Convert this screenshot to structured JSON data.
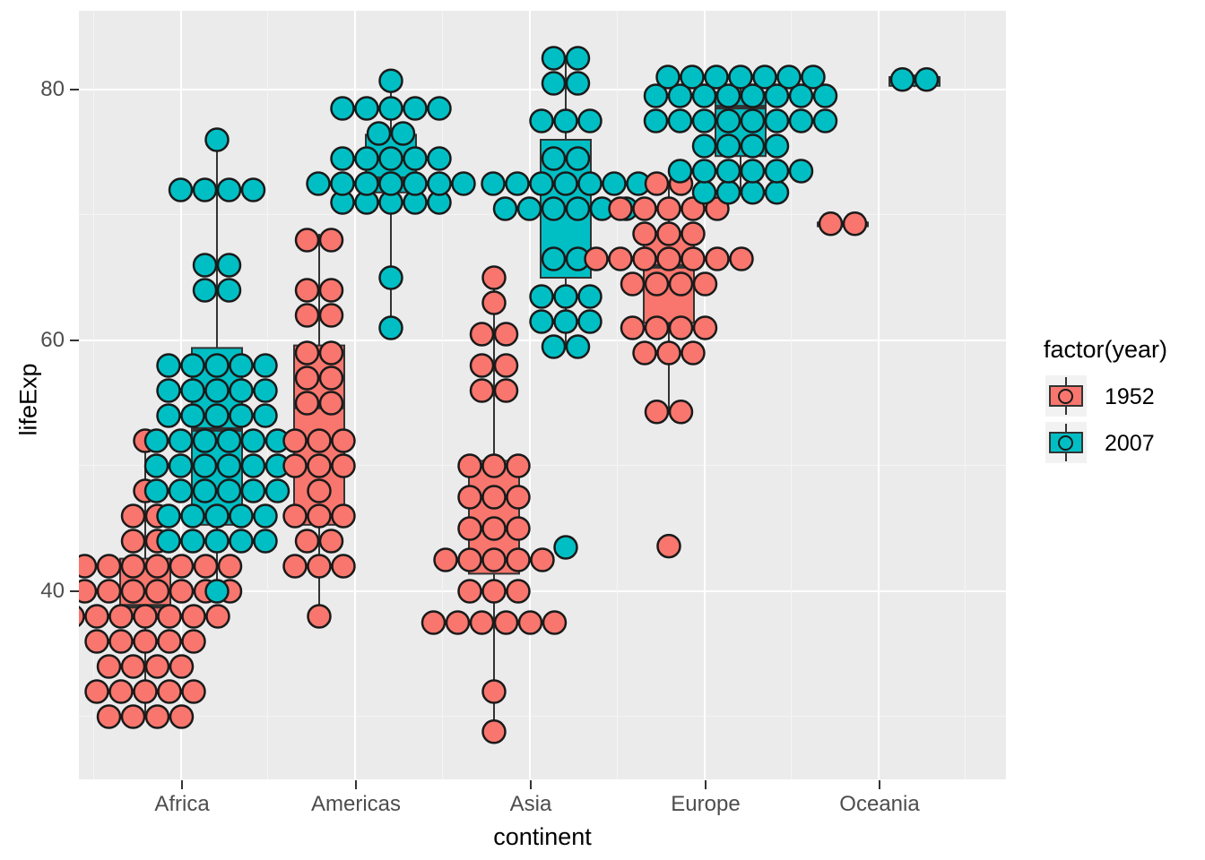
{
  "axes": {
    "y_title": "lifeExp",
    "x_title": "continent",
    "y_ticks": [
      "40",
      "60",
      "80"
    ],
    "x_ticks": [
      "Africa",
      "Americas",
      "Asia",
      "Europe",
      "Oceania"
    ]
  },
  "legend": {
    "title": "factor(year)",
    "items": [
      {
        "label": "1952",
        "color": "#F8766D"
      },
      {
        "label": "2007",
        "color": "#00BFC4"
      }
    ]
  },
  "colors": {
    "panel_bg": "#EBEBEB",
    "grid_major": "#FFFFFF",
    "grid_minor": "#F5F5F5",
    "outline": "#333333",
    "text": "#4D4D4D",
    "series_1952": "#F8766D",
    "series_2007": "#00BFC4"
  },
  "chart_data": {
    "type": "boxplot-dotplot",
    "title": "",
    "xlabel": "continent",
    "ylabel": "lifeExp",
    "ylim": [
      29,
      84
    ],
    "y_ticks": [
      40,
      60,
      80
    ],
    "y_minor_ticks": [
      30,
      50,
      70
    ],
    "grid": true,
    "legend_position": "right",
    "legend_title": "factor(year)",
    "categories": [
      "Africa",
      "Americas",
      "Asia",
      "Europe",
      "Oceania"
    ],
    "series": [
      {
        "name": "1952",
        "color": "#F8766D",
        "boxes": [
          {
            "category": "Africa",
            "lower_whisker": 30.0,
            "q1": 37.8,
            "median": 38.8,
            "q3": 42.6,
            "upper_whisker": 52.7,
            "outliers": []
          },
          {
            "category": "Americas",
            "lower_whisker": 37.6,
            "q1": 45.3,
            "median": 54.7,
            "q3": 59.6,
            "upper_whisker": 68.5,
            "outliers": []
          },
          {
            "category": "Asia",
            "lower_whisker": 28.8,
            "q1": 41.4,
            "median": 44.9,
            "q3": 50.4,
            "upper_whisker": 65.4,
            "outliers": []
          },
          {
            "category": "Europe",
            "lower_whisker": 54.3,
            "q1": 61.4,
            "median": 65.9,
            "q3": 68.5,
            "upper_whisker": 72.7,
            "outliers": [
              43.6
            ]
          },
          {
            "category": "Oceania",
            "lower_whisker": 69.1,
            "q1": 69.1,
            "median": 69.3,
            "q3": 69.4,
            "upper_whisker": 69.4,
            "outliers": []
          }
        ]
      },
      {
        "name": "2007",
        "color": "#00BFC4",
        "boxes": [
          {
            "category": "Africa",
            "lower_whisker": 39.6,
            "q1": 45.3,
            "median": 52.9,
            "q3": 59.4,
            "upper_whisker": 76.4,
            "outliers": []
          },
          {
            "category": "Americas",
            "lower_whisker": 60.9,
            "q1": 71.8,
            "median": 72.9,
            "q3": 76.4,
            "upper_whisker": 80.7,
            "outliers": []
          },
          {
            "category": "Asia",
            "lower_whisker": 59.5,
            "q1": 65.0,
            "median": 72.4,
            "q3": 76.0,
            "upper_whisker": 82.6,
            "outliers": []
          },
          {
            "category": "Europe",
            "lower_whisker": 71.8,
            "q1": 74.7,
            "median": 78.6,
            "q3": 79.8,
            "upper_whisker": 81.7,
            "outliers": []
          },
          {
            "category": "Oceania",
            "lower_whisker": 80.2,
            "q1": 80.3,
            "median": 80.7,
            "q3": 81.0,
            "upper_whisker": 81.2,
            "outliers": []
          }
        ]
      }
    ],
    "dot_rows": [
      {
        "category": "Africa",
        "series": "1952",
        "value": 30.0,
        "n": 4
      },
      {
        "category": "Africa",
        "series": "1952",
        "value": 32.0,
        "n": 5
      },
      {
        "category": "Africa",
        "series": "1952",
        "value": 34.0,
        "n": 4
      },
      {
        "category": "Africa",
        "series": "1952",
        "value": 36.0,
        "n": 5
      },
      {
        "category": "Africa",
        "series": "1952",
        "value": 38.0,
        "n": 7
      },
      {
        "category": "Africa",
        "series": "1952",
        "value": 40.0,
        "n": 8
      },
      {
        "category": "Africa",
        "series": "1952",
        "value": 42.0,
        "n": 8
      },
      {
        "category": "Africa",
        "series": "1952",
        "value": 44.0,
        "n": 2
      },
      {
        "category": "Africa",
        "series": "1952",
        "value": 46.0,
        "n": 2
      },
      {
        "category": "Africa",
        "series": "1952",
        "value": 48.0,
        "n": 1
      },
      {
        "category": "Africa",
        "series": "1952",
        "value": 52.0,
        "n": 1
      },
      {
        "category": "Africa",
        "series": "2007",
        "value": 40.0,
        "n": 1
      },
      {
        "category": "Africa",
        "series": "2007",
        "value": 44.0,
        "n": 5
      },
      {
        "category": "Africa",
        "series": "2007",
        "value": 46.0,
        "n": 5
      },
      {
        "category": "Africa",
        "series": "2007",
        "value": 48.0,
        "n": 6
      },
      {
        "category": "Africa",
        "series": "2007",
        "value": 50.0,
        "n": 6
      },
      {
        "category": "Africa",
        "series": "2007",
        "value": 52.0,
        "n": 6
      },
      {
        "category": "Africa",
        "series": "2007",
        "value": 54.0,
        "n": 5
      },
      {
        "category": "Africa",
        "series": "2007",
        "value": 56.0,
        "n": 5
      },
      {
        "category": "Africa",
        "series": "2007",
        "value": 58.0,
        "n": 5
      },
      {
        "category": "Africa",
        "series": "2007",
        "value": 64.0,
        "n": 2
      },
      {
        "category": "Africa",
        "series": "2007",
        "value": 66.0,
        "n": 2
      },
      {
        "category": "Africa",
        "series": "2007",
        "value": 72.0,
        "n": 4
      },
      {
        "category": "Africa",
        "series": "2007",
        "value": 76.0,
        "n": 1
      },
      {
        "category": "Americas",
        "series": "1952",
        "value": 38.0,
        "n": 1
      },
      {
        "category": "Americas",
        "series": "1952",
        "value": 42.0,
        "n": 3
      },
      {
        "category": "Americas",
        "series": "1952",
        "value": 44.0,
        "n": 2
      },
      {
        "category": "Americas",
        "series": "1952",
        "value": 46.0,
        "n": 3
      },
      {
        "category": "Americas",
        "series": "1952",
        "value": 48.0,
        "n": 1
      },
      {
        "category": "Americas",
        "series": "1952",
        "value": 50.0,
        "n": 3
      },
      {
        "category": "Americas",
        "series": "1952",
        "value": 52.0,
        "n": 3
      },
      {
        "category": "Americas",
        "series": "1952",
        "value": 55.0,
        "n": 2
      },
      {
        "category": "Americas",
        "series": "1952",
        "value": 57.0,
        "n": 2
      },
      {
        "category": "Americas",
        "series": "1952",
        "value": 59.0,
        "n": 2
      },
      {
        "category": "Americas",
        "series": "1952",
        "value": 62.0,
        "n": 2
      },
      {
        "category": "Americas",
        "series": "1952",
        "value": 64.0,
        "n": 2
      },
      {
        "category": "Americas",
        "series": "1952",
        "value": 68.0,
        "n": 2
      },
      {
        "category": "Americas",
        "series": "2007",
        "value": 61.0,
        "n": 1
      },
      {
        "category": "Americas",
        "series": "2007",
        "value": 65.0,
        "n": 1
      },
      {
        "category": "Americas",
        "series": "2007",
        "value": 71.0,
        "n": 5
      },
      {
        "category": "Americas",
        "series": "2007",
        "value": 72.5,
        "n": 7
      },
      {
        "category": "Americas",
        "series": "2007",
        "value": 74.5,
        "n": 5
      },
      {
        "category": "Americas",
        "series": "2007",
        "value": 76.5,
        "n": 2
      },
      {
        "category": "Americas",
        "series": "2007",
        "value": 78.5,
        "n": 5
      },
      {
        "category": "Americas",
        "series": "2007",
        "value": 80.7,
        "n": 1
      },
      {
        "category": "Asia",
        "series": "1952",
        "value": 28.8,
        "n": 1
      },
      {
        "category": "Asia",
        "series": "1952",
        "value": 32.0,
        "n": 1
      },
      {
        "category": "Asia",
        "series": "1952",
        "value": 37.5,
        "n": 6
      },
      {
        "category": "Asia",
        "series": "1952",
        "value": 40.0,
        "n": 3
      },
      {
        "category": "Asia",
        "series": "1952",
        "value": 42.5,
        "n": 5
      },
      {
        "category": "Asia",
        "series": "1952",
        "value": 45.0,
        "n": 3
      },
      {
        "category": "Asia",
        "series": "1952",
        "value": 47.5,
        "n": 3
      },
      {
        "category": "Asia",
        "series": "1952",
        "value": 50.0,
        "n": 3
      },
      {
        "category": "Asia",
        "series": "1952",
        "value": 56.0,
        "n": 2
      },
      {
        "category": "Asia",
        "series": "1952",
        "value": 58.0,
        "n": 2
      },
      {
        "category": "Asia",
        "series": "1952",
        "value": 60.5,
        "n": 2
      },
      {
        "category": "Asia",
        "series": "1952",
        "value": 63.0,
        "n": 1
      },
      {
        "category": "Asia",
        "series": "1952",
        "value": 65.0,
        "n": 1
      },
      {
        "category": "Asia",
        "series": "2007",
        "value": 43.5,
        "n": 1
      },
      {
        "category": "Asia",
        "series": "2007",
        "value": 59.5,
        "n": 2
      },
      {
        "category": "Asia",
        "series": "2007",
        "value": 61.5,
        "n": 3
      },
      {
        "category": "Asia",
        "series": "2007",
        "value": 63.5,
        "n": 3
      },
      {
        "category": "Asia",
        "series": "2007",
        "value": 66.5,
        "n": 2
      },
      {
        "category": "Asia",
        "series": "2007",
        "value": 70.5,
        "n": 6
      },
      {
        "category": "Asia",
        "series": "2007",
        "value": 72.5,
        "n": 7
      },
      {
        "category": "Asia",
        "series": "2007",
        "value": 74.5,
        "n": 2
      },
      {
        "category": "Asia",
        "series": "2007",
        "value": 77.5,
        "n": 3
      },
      {
        "category": "Asia",
        "series": "2007",
        "value": 80.5,
        "n": 2
      },
      {
        "category": "Asia",
        "series": "2007",
        "value": 82.5,
        "n": 2
      },
      {
        "category": "Europe",
        "series": "1952",
        "value": 43.6,
        "n": 1
      },
      {
        "category": "Europe",
        "series": "1952",
        "value": 54.3,
        "n": 2
      },
      {
        "category": "Europe",
        "series": "1952",
        "value": 59.0,
        "n": 3
      },
      {
        "category": "Europe",
        "series": "1952",
        "value": 61.0,
        "n": 4
      },
      {
        "category": "Europe",
        "series": "1952",
        "value": 64.5,
        "n": 4
      },
      {
        "category": "Europe",
        "series": "1952",
        "value": 66.5,
        "n": 7
      },
      {
        "category": "Europe",
        "series": "1952",
        "value": 68.5,
        "n": 3
      },
      {
        "category": "Europe",
        "series": "1952",
        "value": 70.5,
        "n": 5
      },
      {
        "category": "Europe",
        "series": "1952",
        "value": 72.5,
        "n": 2
      },
      {
        "category": "Europe",
        "series": "2007",
        "value": 71.8,
        "n": 4
      },
      {
        "category": "Europe",
        "series": "2007",
        "value": 73.5,
        "n": 6
      },
      {
        "category": "Europe",
        "series": "2007",
        "value": 75.5,
        "n": 4
      },
      {
        "category": "Europe",
        "series": "2007",
        "value": 77.5,
        "n": 8
      },
      {
        "category": "Europe",
        "series": "2007",
        "value": 79.5,
        "n": 8
      },
      {
        "category": "Europe",
        "series": "2007",
        "value": 81.0,
        "n": 7
      },
      {
        "category": "Oceania",
        "series": "1952",
        "value": 69.3,
        "n": 2
      },
      {
        "category": "Oceania",
        "series": "2007",
        "value": 80.8,
        "n": 2
      }
    ]
  }
}
